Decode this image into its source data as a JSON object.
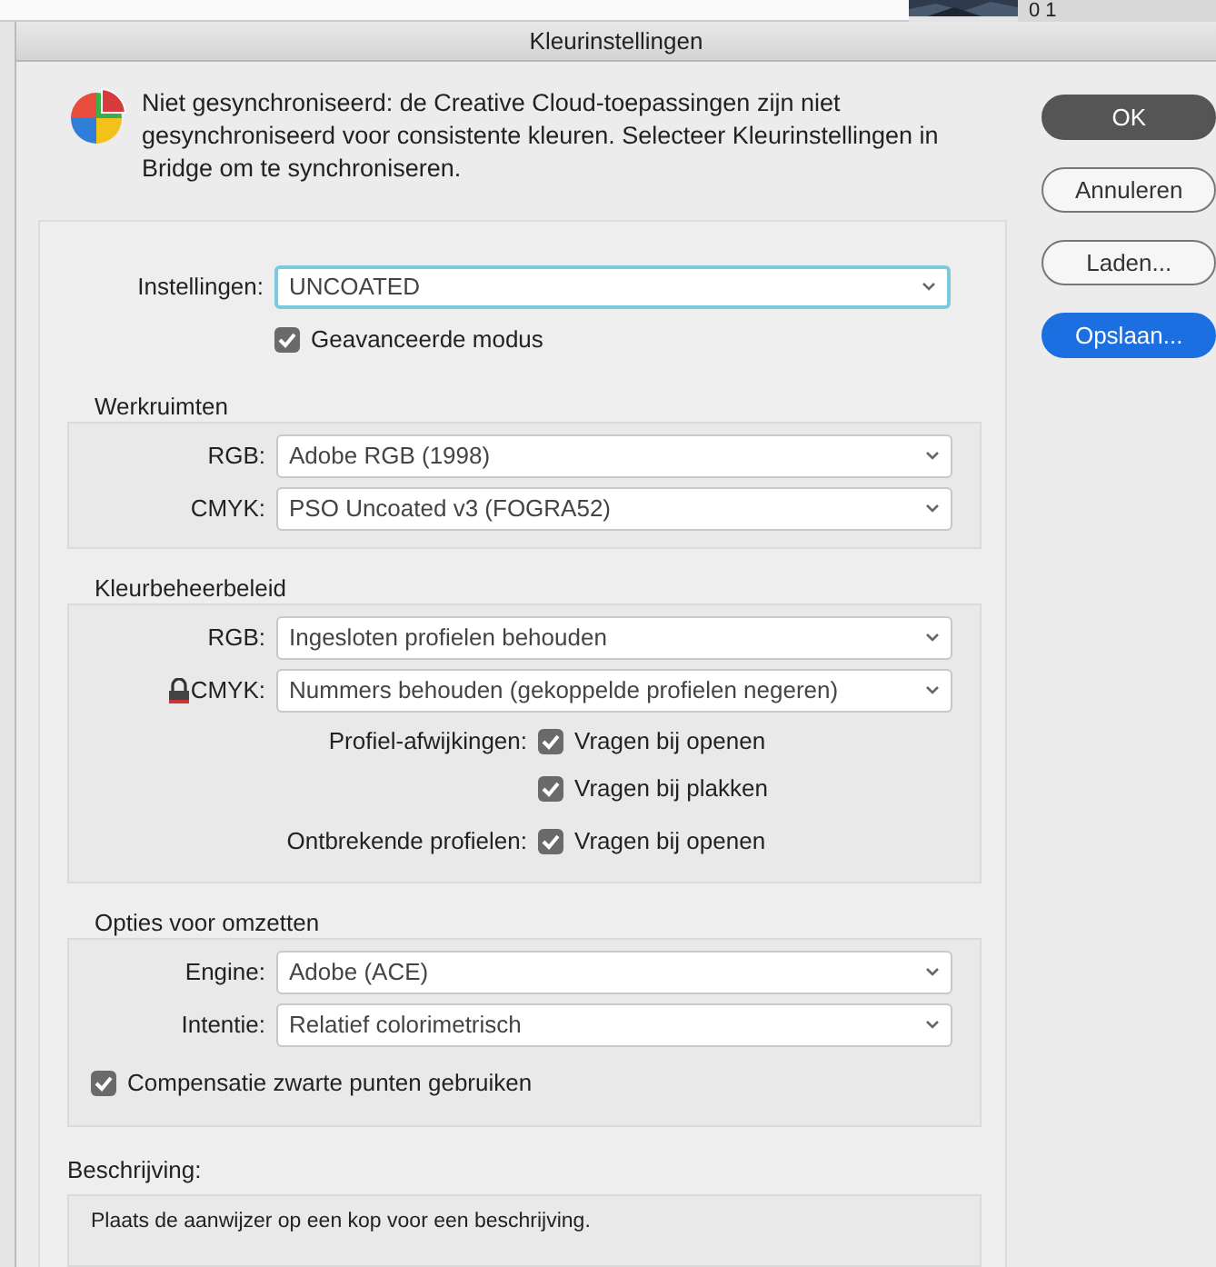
{
  "background": {
    "text": "0 1"
  },
  "window": {
    "title": "Kleurinstellingen"
  },
  "message": "Niet gesynchroniseerd: de Creative Cloud-toepassingen zijn niet gesynchroniseerd voor consistente kleuren. Selecteer Kleurinstellingen in Bridge om te synchroniseren.",
  "buttons": [
    {
      "label": "OK",
      "kind": "default"
    },
    {
      "label": "Annuleren",
      "kind": "plain"
    },
    {
      "label": "Laden...",
      "kind": "plain"
    },
    {
      "label": "Opslaan...",
      "kind": "primary"
    }
  ],
  "settings": {
    "label": "Instellingen:",
    "value": "UNCOATED"
  },
  "advanced_mode": {
    "label": "Geavanceerde modus",
    "checked": true
  },
  "sections": [
    {
      "title": "Werkruimten",
      "rows": [
        {
          "kind": "select",
          "label": "RGB:",
          "value": "Adobe RGB (1998)",
          "locked": false
        },
        {
          "kind": "select",
          "label": "CMYK:",
          "value": "PSO Uncoated v3 (FOGRA52)",
          "locked": false
        }
      ]
    },
    {
      "title": "Kleurbeheerbeleid",
      "rows": [
        {
          "kind": "select",
          "label": "RGB:",
          "value": "Ingesloten profielen behouden",
          "locked": false
        },
        {
          "kind": "select",
          "label": "CMYK:",
          "value": "Nummers behouden (gekoppelde profielen negeren)",
          "locked": true
        },
        {
          "kind": "check",
          "label": "Profiel-afwijkingen:",
          "option": "Vragen bij openen",
          "checked": true
        },
        {
          "kind": "check",
          "option": "Vragen bij plakken",
          "checked": true
        },
        {
          "kind": "check",
          "label": "Ontbrekende profielen:",
          "option": "Vragen bij openen",
          "checked": true
        }
      ]
    },
    {
      "title": "Opties voor omzetten",
      "rows": [
        {
          "kind": "select",
          "label": "Engine:",
          "value": "Adobe (ACE)",
          "locked": false
        },
        {
          "kind": "select",
          "label": "Intentie:",
          "value": "Relatief colorimetrisch",
          "locked": false
        },
        {
          "kind": "wide-check",
          "option": "Compensatie zwarte punten gebruiken",
          "checked": true
        }
      ]
    }
  ],
  "description": {
    "title": "Beschrijving:",
    "text": "Plaats de aanwijzer op een kop voor een beschrijving."
  }
}
